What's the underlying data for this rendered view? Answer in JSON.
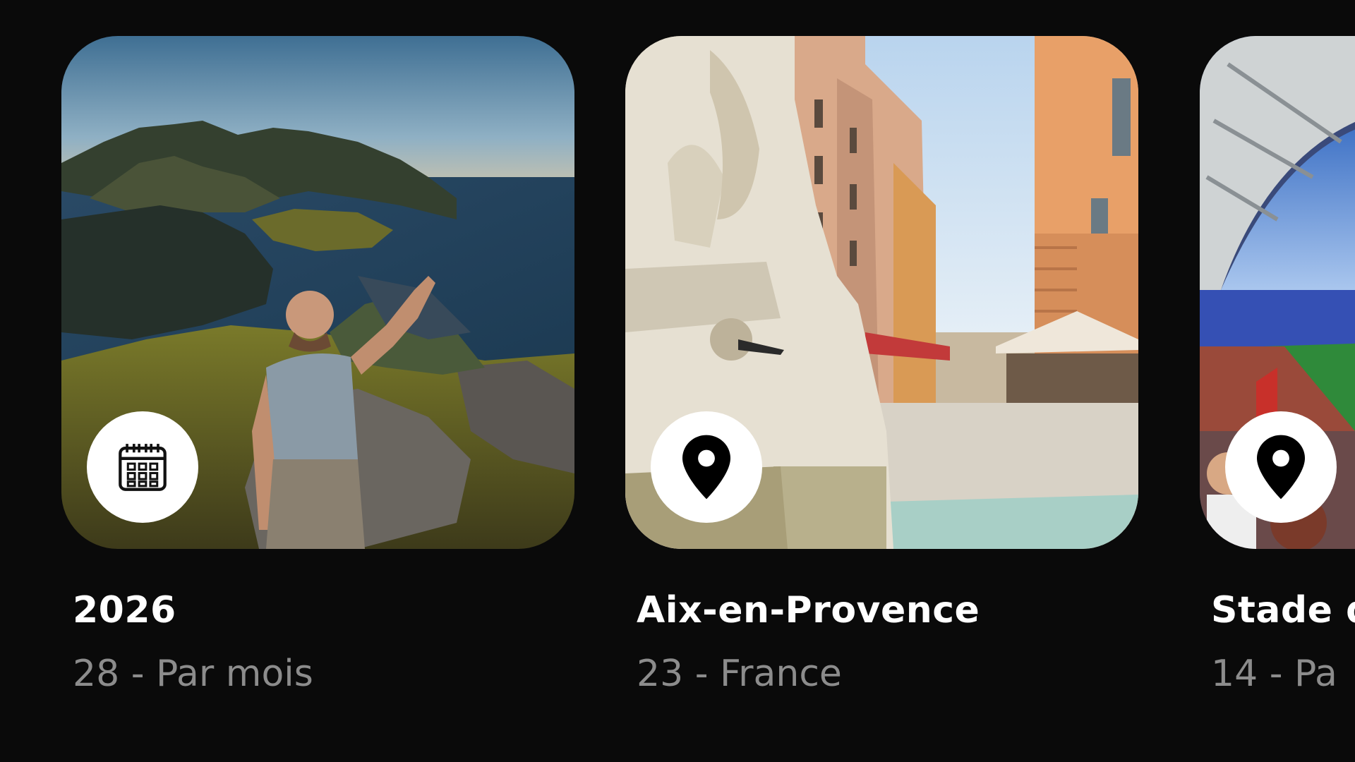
{
  "cards": [
    {
      "title": "2026",
      "subtitle": "28 - Par mois",
      "badge_icon": "calendar-icon",
      "photo": "selfie-on-mountain-over-fjord"
    },
    {
      "title": "Aix-en-Provence",
      "subtitle": "23 - France",
      "badge_icon": "location-pin-icon",
      "photo": "fountain-and-street"
    },
    {
      "title": "Stade d",
      "subtitle": "14 - Pa",
      "badge_icon": "location-pin-icon",
      "photo": "stadium-crowd"
    }
  ],
  "colors": {
    "background": "#0a0a0a",
    "title": "#ffffff",
    "subtitle": "#8c8c8c",
    "badge": "#ffffff"
  }
}
